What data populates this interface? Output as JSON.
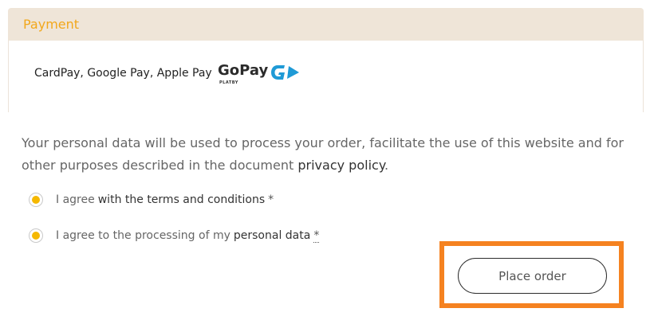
{
  "payment": {
    "section_title": "Payment",
    "methods_label": "CardPay, Google Pay, Apple Pay",
    "logo_word": "GoPay",
    "logo_sub": "PLATBY"
  },
  "privacy": {
    "text": "Your personal data will be used to process your order, facilitate the use of this website and for other purposes described in the document",
    "link": "privacy policy",
    "end": "."
  },
  "consents": [
    {
      "prefix": "I agree",
      "link": "with the terms and conditions",
      "required": "*"
    },
    {
      "prefix": "I agree to the processing of my",
      "link": "personal data",
      "required": "*"
    }
  ],
  "actions": {
    "place_order": "Place order"
  },
  "colors": {
    "accent": "#f2a71b",
    "radio_fill": "#f5b800",
    "highlight": "#f58220",
    "header_bg": "#efe5d8",
    "gopay_blue": "#1f9ad6"
  },
  "icons": [
    "gopay-logo",
    "radio-selected"
  ]
}
